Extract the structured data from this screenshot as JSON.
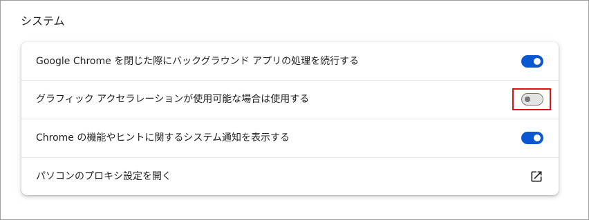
{
  "section": {
    "title": "システム"
  },
  "settings": {
    "items": [
      {
        "label": "Google Chrome を閉じた際にバックグラウンド アプリの処理を続行する",
        "control": "toggle",
        "state": "on"
      },
      {
        "label": "グラフィック アクセラレーションが使用可能な場合は使用する",
        "control": "toggle",
        "state": "off",
        "highlighted": true
      },
      {
        "label": "Chrome の機能やヒントに関するシステム通知を表示する",
        "control": "toggle",
        "state": "on"
      },
      {
        "label": "パソコンのプロキシ設定を開く",
        "control": "external-link",
        "icon": "open-in-new-icon"
      }
    ]
  },
  "colors": {
    "toggle_on": "#0b57d0",
    "toggle_off_track": "#e3e3e3",
    "toggle_off_outline": "#747775",
    "highlight_box": "#e01010",
    "divider": "#e8eaed"
  }
}
